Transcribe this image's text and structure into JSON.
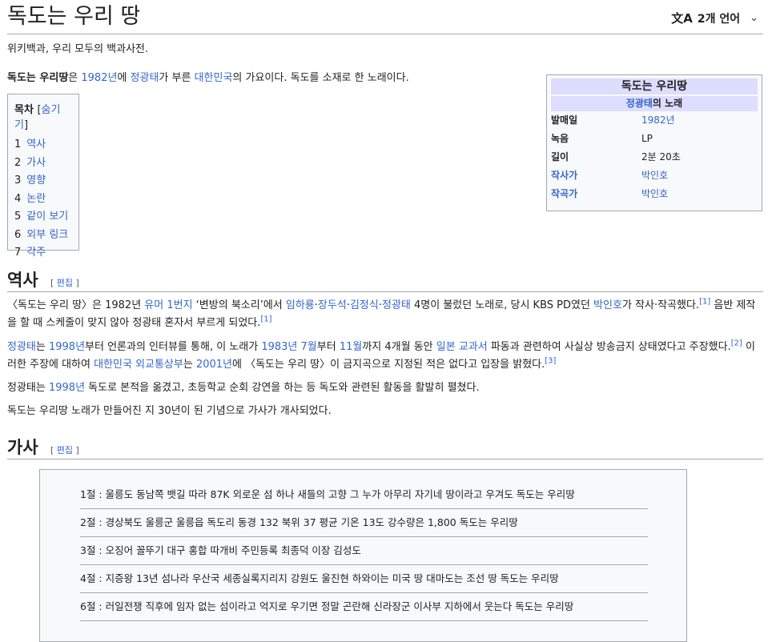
{
  "header": {
    "title": "독도는 우리 땅",
    "lang_icon": "文A",
    "lang_label": "2개 언어",
    "chevron": "⌄"
  },
  "tagline": "위키백과, 우리 모두의 백과사전.",
  "intro": {
    "subject": "독도는 우리땅",
    "t1": "은 ",
    "year": "1982년",
    "t2": "에 ",
    "singer": "정광태",
    "t3": "가 부른 ",
    "country": "대한민국",
    "t4": "의 가요이다. 독도를 소재로 한 노래이다."
  },
  "toc": {
    "title": "목차",
    "toggle_open": "[",
    "toggle": "숨기기",
    "toggle_close": "]",
    "items": [
      {
        "num": "1",
        "label": "역사"
      },
      {
        "num": "2",
        "label": "가사"
      },
      {
        "num": "3",
        "label": "영향"
      },
      {
        "num": "4",
        "label": "논란"
      },
      {
        "num": "5",
        "label": "같이 보기"
      },
      {
        "num": "6",
        "label": "외부 링크"
      },
      {
        "num": "7",
        "label": "각주"
      }
    ]
  },
  "infobox": {
    "title": "독도는 우리땅",
    "sub_link": "정광태",
    "sub_rest": "의 노래",
    "rows": [
      {
        "key": "발매일",
        "value": "1982년"
      },
      {
        "key": "녹음",
        "value": "LP"
      },
      {
        "key": "길이",
        "value": "2분 20초"
      },
      {
        "key": "작사가",
        "value": "박인호"
      },
      {
        "key": "작곡가",
        "value": "박인호"
      }
    ]
  },
  "section_history": {
    "heading": "역사",
    "edit_open": "[",
    "edit": "편집",
    "edit_close": "]",
    "p1": {
      "a": "〈독도는 우리 땅〉은 1982년 ",
      "show1": "유머 1번지",
      "b": " ‘변방의 북소리’에서 ",
      "n1": "임하룡",
      "sep1": "·",
      "n2": "장두석",
      "sep2": "·",
      "n3": "김정식",
      "sep3": "·",
      "n4": "정광태",
      "c": " 4명이 불렀던 노래로, 당시 KBS PD였던 ",
      "pd": "박인호",
      "d": "가 작사·작곡했다.",
      "ref1": "[1]",
      "e": " 음반 제작을 할 때 스케줄이 맞지 않아 정광태 혼자서 부르게 되었다.",
      "ref2": "[1]"
    },
    "p2": {
      "a": "정광태",
      "b": "는 ",
      "y1": "1998년",
      "c": "부터 언론과의 인터뷰를 통해, 이 노래가 ",
      "y2": "1983년",
      "sp1": " ",
      "m1": "7월",
      "d": "부터 ",
      "m2": "11월",
      "e": "까지 4개월 동안 ",
      "tb": "일본 교과서",
      "f": " 파동과 관련하여 사실상 방송금지 상태였다고 주장했다.",
      "ref1": "[2]",
      "g": " 이러한 주장에 대하여 ",
      "mofa": "대한민국 외교통상부",
      "h": "는 ",
      "y3": "2001년",
      "i": "에 〈독도는 우리 땅〉이 금지곡으로 지정된 적은 없다고 입장을 밝혔다.",
      "ref2": "[3]"
    },
    "p3": {
      "a": "정광태는 ",
      "y": "1998년",
      "b": " 독도로 본적을 옮겼고, 초등학교 순회 강연을 하는 등 독도와 관련된 활동을 활발히 펼쳤다."
    },
    "p4": "독도는 우리땅 노래가 만들어진 지 30년이 된 기념으로 가사가 개사되었다."
  },
  "section_lyrics": {
    "heading": "가사",
    "edit_open": "[",
    "edit": "편집",
    "edit_close": "]",
    "lines": [
      "1절 : 울릉도 동남쪽 뱃길 따라 87K 외로운 섬 하나 새들의 고향 그 누가 아무리 자기네 땅이라고 우겨도 독도는 우리땅",
      "2절 : 경상북도 울릉군 울릉읍 독도리 동경 132 북위 37 평균 기온 13도 강수량은 1,800 독도는 우리땅",
      "3절 : 오징어 꼴뚜기 대구 홍합 따개비 주민등록 최종덕 이장 김성도",
      "4절 : 지증왕 13년 섬나라 우산국 세종실록지리지 강원도 울진현 하와이는 미국 땅 대마도는 조선 땅 독도는 우리땅",
      "6절 : 러일전쟁 직후에 임자 없는 섬이라고 억지로 우기면 정말 곤란해 신라장군 이사부 지하에서 웃는다 독도는 우리땅"
    ]
  }
}
